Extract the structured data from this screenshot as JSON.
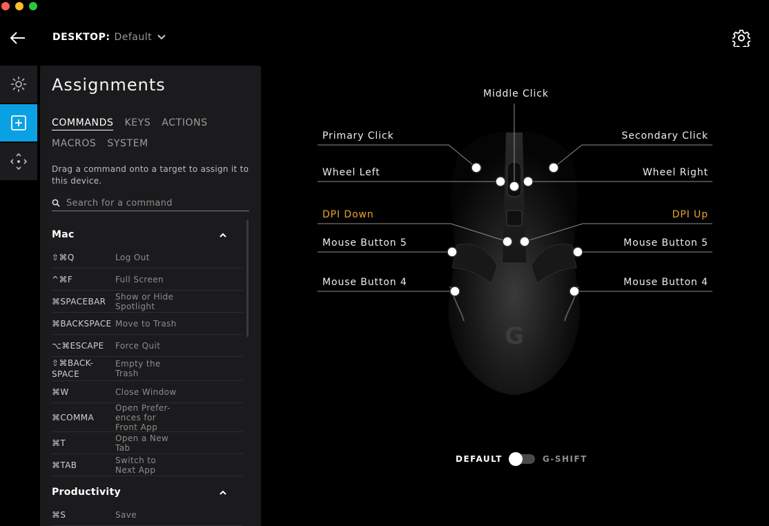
{
  "header": {
    "profile_prefix": "DESKTOP:",
    "profile_value": "Default"
  },
  "rail": {
    "items": [
      {
        "icon": "lighting-icon",
        "active": false
      },
      {
        "icon": "assignments-icon",
        "active": true
      },
      {
        "icon": "dpi-icon",
        "active": false
      }
    ]
  },
  "panel": {
    "title": "Assignments",
    "tabs": [
      "COMMANDS",
      "KEYS",
      "ACTIONS",
      "MACROS",
      "SYSTEM"
    ],
    "active_tab": "COMMANDS",
    "hint": "Drag a command onto a target to assign it to this device.",
    "search_placeholder": "Search for a command",
    "sections": [
      {
        "title": "Mac",
        "rows": [
          {
            "key": "⇧⌘Q",
            "action": "Log Out"
          },
          {
            "key": "^⌘F",
            "action": "Full Screen"
          },
          {
            "key": "⌘SPACEBAR",
            "action": "Show or Hide Spotlight"
          },
          {
            "key": "⌘BACKSPACE",
            "action": "Move to Trash"
          },
          {
            "key": "⌥⌘ESCAPE",
            "action": "Force Quit"
          },
          {
            "key": "⇧⌘BACK-SPACE",
            "action": "Empty the Trash"
          },
          {
            "key": "⌘W",
            "action": "Close Window"
          },
          {
            "key": "⌘COMMA",
            "action": "Open Prefer-ences for Front App"
          },
          {
            "key": "⌘T",
            "action": "Open a New Tab"
          },
          {
            "key": "⌘TAB",
            "action": "Switch to Next App"
          }
        ]
      },
      {
        "title": "Productivity",
        "rows": [
          {
            "key": "⌘S",
            "action": "Save"
          }
        ]
      }
    ]
  },
  "mouse_labels": {
    "middle_click": "Middle Click",
    "primary_click": "Primary Click",
    "secondary_click": "Secondary Click",
    "wheel_left": "Wheel Left",
    "wheel_right": "Wheel Right",
    "dpi_down": "DPI Down",
    "dpi_up": "DPI Up",
    "mouse_button_5_left": "Mouse Button 5",
    "mouse_button_5_right": "Mouse Button 5",
    "mouse_button_4_left": "Mouse Button 4",
    "mouse_button_4_right": "Mouse Button 4"
  },
  "mode_toggle": {
    "left_label": "DEFAULT",
    "right_label": "G-SHIFT",
    "selected": "DEFAULT"
  },
  "colors": {
    "accent": "#0aa1e4",
    "dpi_label": "#e9a52a",
    "background": "#000000",
    "panel": "#1b1b1d"
  }
}
